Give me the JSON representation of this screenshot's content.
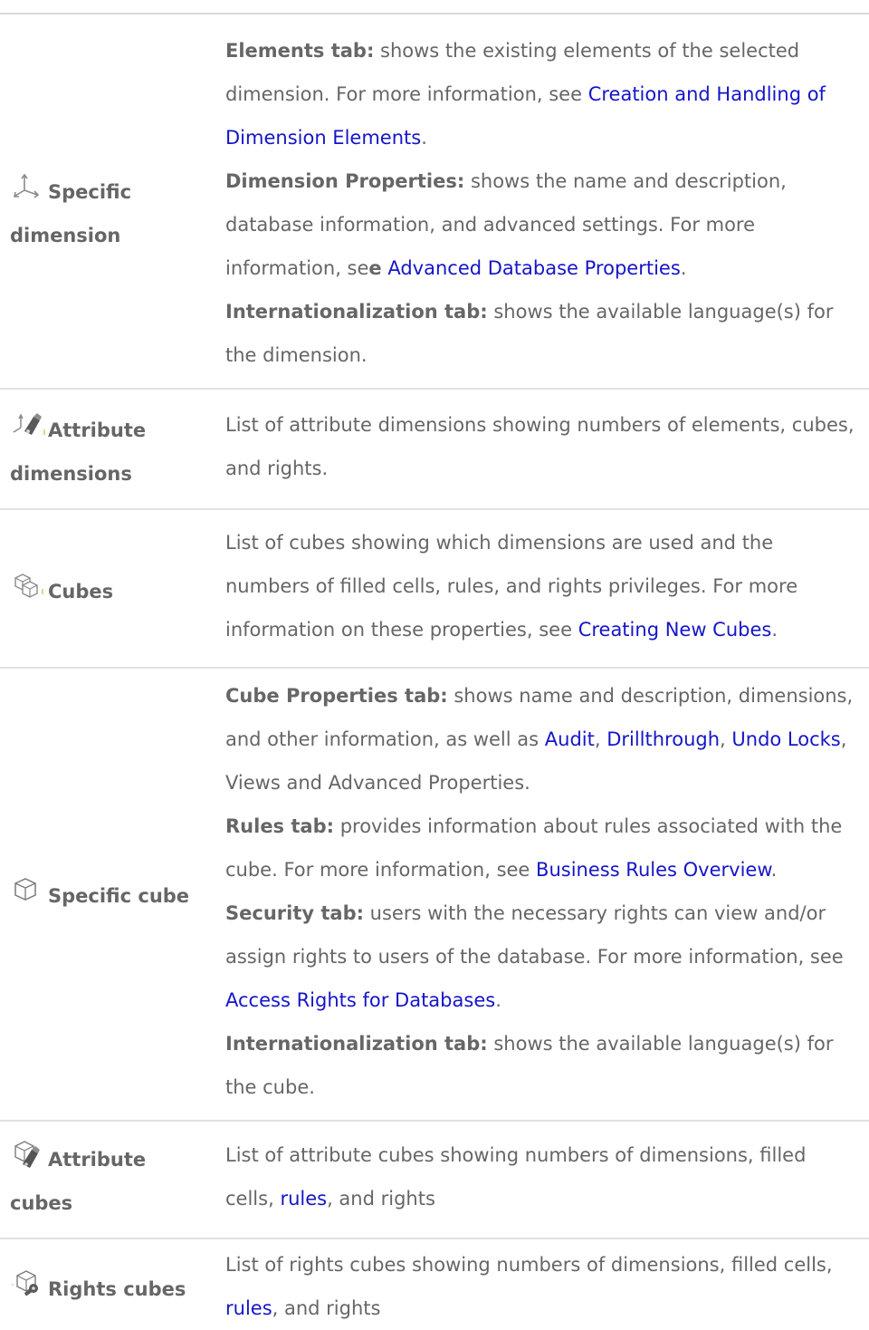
{
  "rows": [
    {
      "label_parts": [
        "Specific",
        "dimension"
      ],
      "icon": "dimension-axes-icon",
      "paragraphs": [
        {
          "head": "Elements tab:",
          "text": " shows the existing elements of the selected dimension. For more information, see ",
          "link": "Creation and Handling of Dimension Elements",
          "tail": "."
        },
        {
          "head": "Dimension Properties:",
          "text": " shows the name and description, database information, and advanced settings. For more information, se",
          "bold_mid": "e",
          "text2": " ",
          "link": "Advanced Database Properties",
          "tail": "."
        },
        {
          "head": "Internationalization tab:",
          "text": " shows the available language(s) for the dimension."
        }
      ]
    },
    {
      "label_parts": [
        "Attribute",
        "dimensions"
      ],
      "icon": "attribute-dimension-icon",
      "text": "List of attribute dimensions showing numbers of elements, cubes, and rights."
    },
    {
      "label_parts": [
        "Cubes"
      ],
      "icon": "cubes-icon",
      "text": "List of cubes showing which dimensions are used and the numbers of filled cells, rules, and rights privileges. For more information on these properties, see ",
      "link": "Creating New Cubes",
      "tail": "."
    },
    {
      "label_parts": [
        "Specific cube"
      ],
      "icon": "cube-icon",
      "paragraphs": [
        {
          "head": "Cube Properties tab:",
          "text": " shows name and description, dimensions, and other information, as well as ",
          "links": [
            "Audit",
            "Drillthrough",
            "Undo Locks"
          ],
          "tail": ", Views and Advanced Properties."
        },
        {
          "head": "Rules tab:",
          "text": " provides information about rules associated with the cube. For more information, see ",
          "link": "Business Rules Overview",
          "tail": "."
        },
        {
          "head": "Security tab:",
          "text": " users with the necessary rights can view and/or assign rights to users of the database. For more information, see ",
          "link": "Access Rights for Databases",
          "tail": "."
        },
        {
          "head": "Internationalization tab:",
          "text": " shows the available language(s) for the cube."
        }
      ]
    },
    {
      "label_parts": [
        "Attribute",
        "cubes"
      ],
      "icon": "attribute-cube-icon",
      "text": "List of attribute cubes showing numbers of dimensions, filled cells, ",
      "link": "rules",
      "tail": ", and rights"
    },
    {
      "label_parts": [
        "Rights cubes"
      ],
      "icon": "rights-cube-icon",
      "text": "List of rights cubes showing numbers of dimensions, filled cells, ",
      "link": "rules",
      "tail": ", and rights"
    }
  ],
  "colors": {
    "text": "#666666",
    "link": "#1515c8",
    "rule": "#e1e1e1"
  },
  "separators": [
    ", ",
    ", "
  ]
}
